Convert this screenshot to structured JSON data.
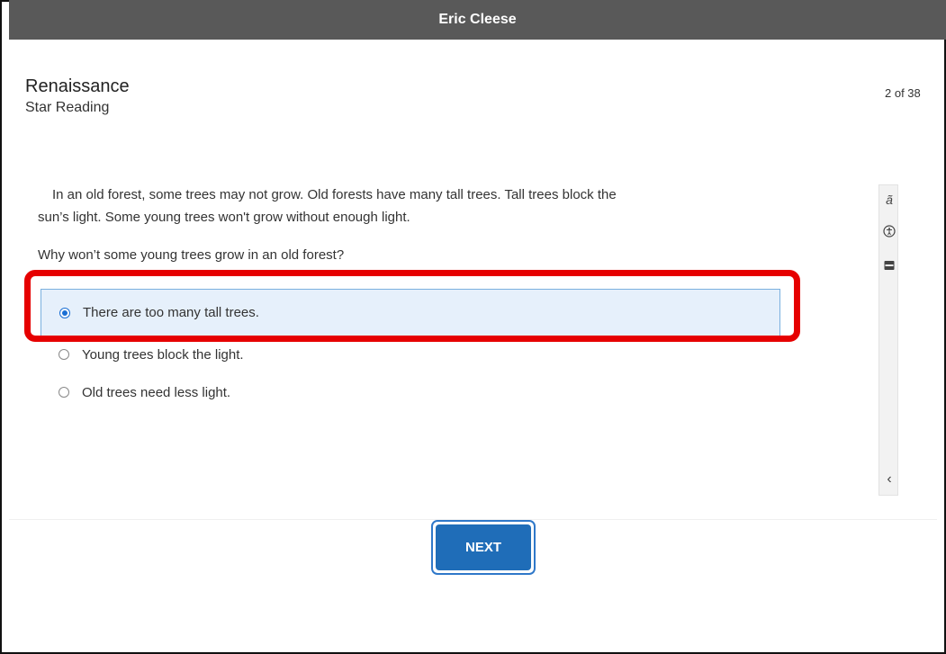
{
  "header": {
    "user_name": "Eric Cleese"
  },
  "brand": {
    "title": "Renaissance",
    "subtitle": "Star Reading"
  },
  "progress": {
    "text": "2 of 38"
  },
  "passage": "In an old forest, some trees may not grow. Old forests have many tall trees. Tall trees block the sun’s light. Some young trees won't grow without enough light.",
  "question": "Why won’t some young trees grow in an old forest?",
  "choices": [
    {
      "label": "There are too many tall trees.",
      "selected": true
    },
    {
      "label": "Young trees block the light.",
      "selected": false
    },
    {
      "label": "Old trees need less light.",
      "selected": false
    }
  ],
  "tools": [
    {
      "icon": "translate-icon",
      "glyph": "ã"
    },
    {
      "icon": "accessibility-icon",
      "glyph": "accessibility"
    },
    {
      "icon": "line-reader-icon",
      "glyph": "line-reader"
    },
    {
      "icon": "collapse-chevron-icon",
      "glyph": "‹"
    }
  ],
  "next_button": {
    "label": "NEXT"
  },
  "colors": {
    "topbar": "#595959",
    "accent": "#1f6db8",
    "highlight": "#e60000",
    "selected_bg": "#e6f0fb"
  }
}
